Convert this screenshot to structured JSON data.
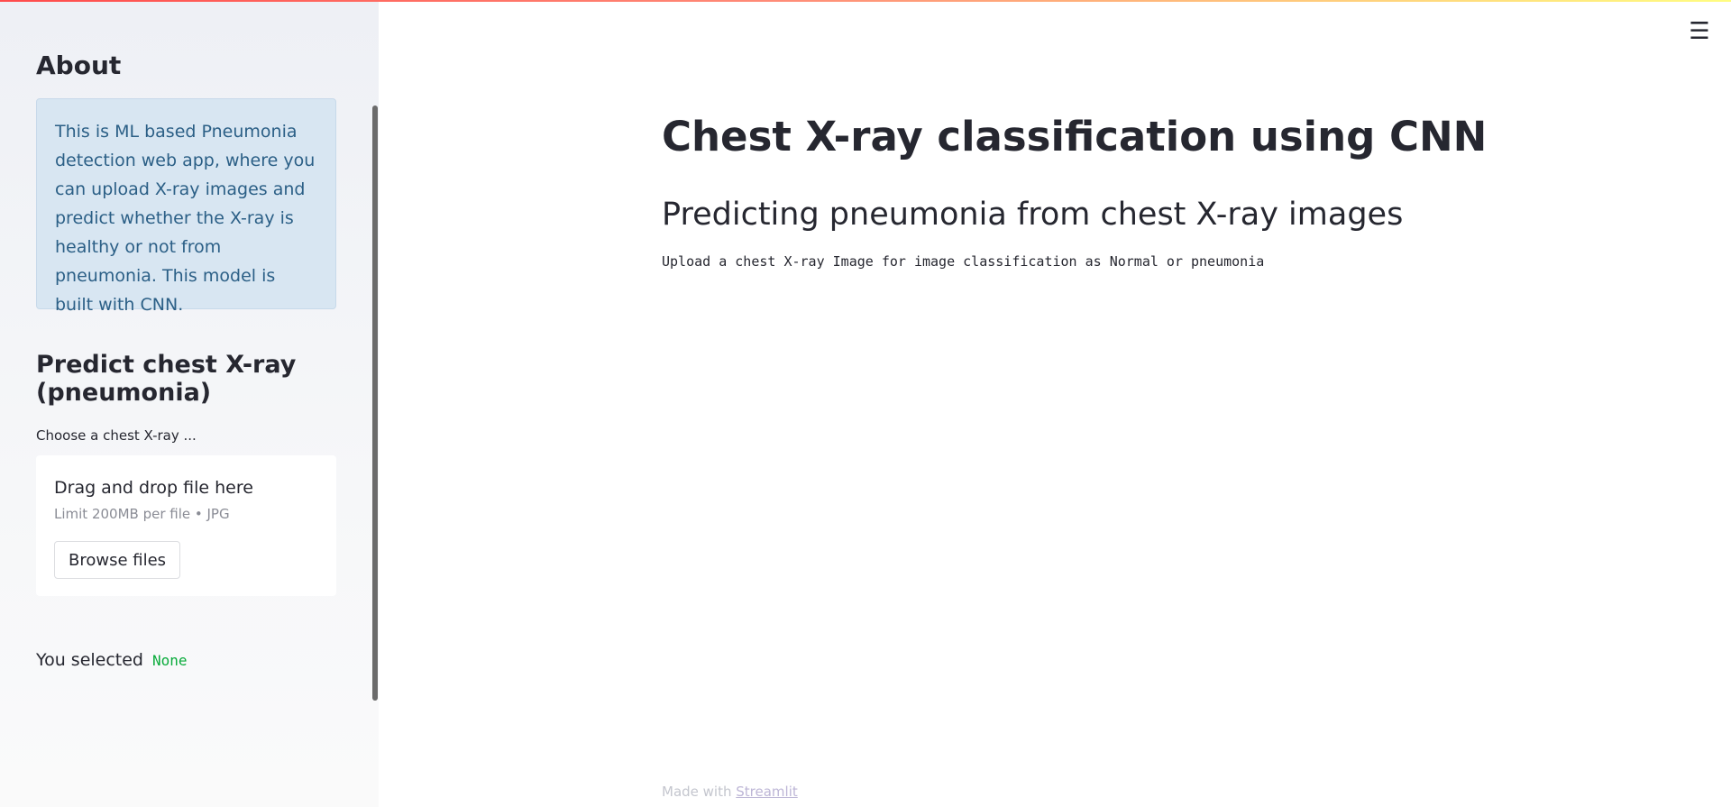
{
  "colors": {
    "accent": "#ff4b4b",
    "info_bg": "#d8e6f2",
    "info_text": "#2b5f86",
    "selected_value": "#09ab3b"
  },
  "sidebar": {
    "about_title": "About",
    "info_text": "This is ML based Pneumonia detection web app, where you can upload X-ray images and predict whether the X-ray is healthy or not from pneumonia. This model is built with CNN.",
    "predict_title": "Predict chest X-ray (pneumonia)",
    "uploader": {
      "label": "Choose a chest X-ray ...",
      "drop_text": "Drag and drop file here",
      "limit_text": "Limit 200MB per file • JPG",
      "browse_label": "Browse files"
    },
    "selected": {
      "label": "You selected",
      "value": "None"
    }
  },
  "main": {
    "menu_icon": "hamburger-menu-icon",
    "menu_glyph": "☰",
    "title": "Chest X-ray classification using CNN",
    "subtitle": "Predicting pneumonia from chest X-ray images",
    "instruction": "Upload a chest X-ray Image for image classification as Normal or pneumonia"
  },
  "footer": {
    "made_with": "Made with",
    "link_text": "Streamlit"
  }
}
